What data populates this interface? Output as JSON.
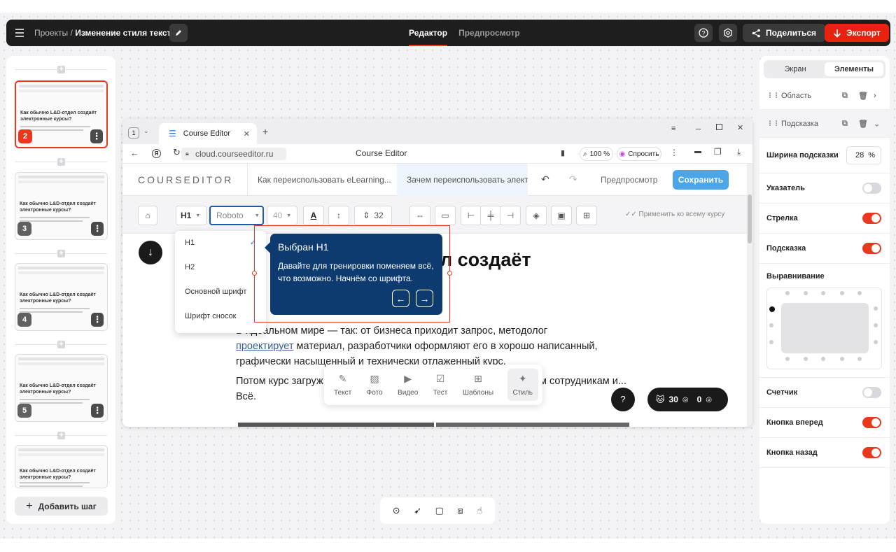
{
  "topbar": {
    "breadcrumb_root": "Проекты",
    "breadcrumb_sep": "/",
    "breadcrumb_current": "Изменение стиля текста",
    "tab_editor": "Редактор",
    "tab_preview": "Предпросмотр",
    "share_label": "Поделиться",
    "export_label": "Экспорт"
  },
  "steps": {
    "items": [
      {
        "number": "2",
        "title": "Как обычно L&D-отдел создаёт электронные курсы?",
        "selected": true
      },
      {
        "number": "3",
        "title": "Как обычно L&D-отдел создаёт электронные курсы?",
        "selected": false
      },
      {
        "number": "4",
        "title": "Как обычно L&D-отдел создаёт электронные курсы?",
        "selected": false
      },
      {
        "number": "5",
        "title": "Как обычно L&D-отдел создаёт электронные курсы?",
        "selected": false
      },
      {
        "number": "",
        "title": "Как обычно L&D-отдел создаёт электронные курсы?",
        "selected": false
      }
    ],
    "add_step_label": "Добавить шаг"
  },
  "browser": {
    "tab_count": "1",
    "tab_title": "Course Editor",
    "url": "cloud.courseeditor.ru",
    "page_title": "Course Editor",
    "zoom": "100 %",
    "ask_label": "Спросить"
  },
  "app": {
    "logo": "COURSEDITOR",
    "tab1": "Как переиспользовать eLearning...",
    "tab2": "Зачем переиспользовать электронные",
    "preview_label": "Предпросмотр",
    "save_label": "Сохранить",
    "toolbar": {
      "heading_select": "H1",
      "font_select": "Roboto",
      "font_size": "40",
      "line_spacing": "32",
      "apply_all": "Применить ко всему курсу"
    },
    "heading_menu": [
      "H1",
      "H2",
      "Основной шрифт",
      "Шрифт сносок"
    ],
    "heading_partial": "л создаёт",
    "paragraph1_a": "В идеальном мире — так: от бизнеса приходит запрос, методолог",
    "paragraph1_link": "проектирует",
    "paragraph1_b": " материал, разработчики оформляют его в хорошо написанный,",
    "paragraph1_c": "графически насыщенный и технически отлаженный курс.",
    "paragraph2_a": "Потом курс загруж",
    "paragraph2_b": "м сотрудникам и...",
    "paragraph2_c": "Всё.",
    "insert_menu": [
      "Текст",
      "Фото",
      "Видео",
      "Тест",
      "Шаблоны",
      "Стиль"
    ],
    "counter_a": "30",
    "counter_b": "0"
  },
  "hint": {
    "title": "Выбран H1",
    "text": "Давайте для тренировки поменяем всё, что возможно. Начнём со шрифта."
  },
  "props": {
    "tab_screen": "Экран",
    "tab_elements": "Элементы",
    "layer_area": "Область",
    "layer_hint": "Подсказка",
    "width_label": "Ширина подсказки",
    "width_value": "28",
    "width_unit": "%",
    "pointer_label": "Указатель",
    "pointer_on": false,
    "arrow_label": "Стрелка",
    "arrow_on": true,
    "hint_label": "Подсказка",
    "hint_on": true,
    "align_label": "Выравнивание",
    "counter_label": "Счетчик",
    "counter_on": false,
    "next_label": "Кнопка вперед",
    "next_on": true,
    "back_label": "Кнопка назад",
    "back_on": true
  },
  "colors": {
    "accent": "#e8381e",
    "tooltip": "#0d3b70",
    "save": "#4aa6e8"
  }
}
